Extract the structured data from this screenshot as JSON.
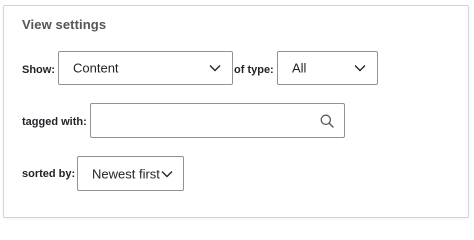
{
  "panel": {
    "legend": "View settings"
  },
  "filters": {
    "show_label": "Show:",
    "show_value": "Content",
    "type_label": "of type:",
    "type_value": "All",
    "tagged_label": "tagged with:",
    "tagged_value": "",
    "sorted_label": "sorted by:",
    "sorted_value": "Newest first"
  },
  "icons": {
    "show_dropdown": "chevron-down-icon",
    "type_dropdown": "chevron-down-icon",
    "tagged_search": "search-icon",
    "sort_dropdown": "chevron-down-icon"
  }
}
